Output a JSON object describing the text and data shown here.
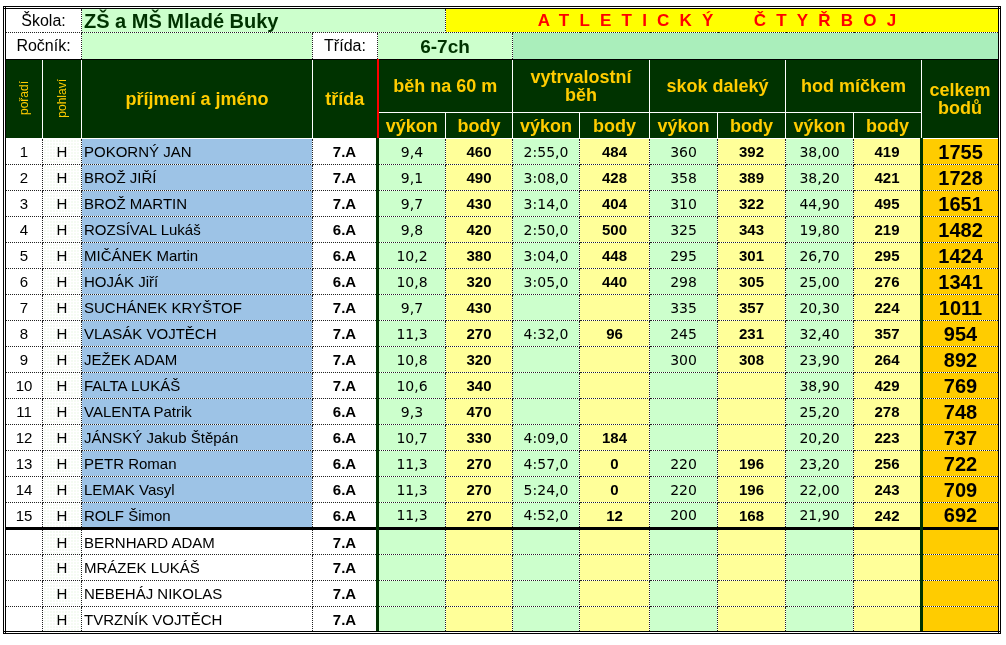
{
  "school": {
    "label": "Škola:",
    "value": "ZŠ a MŠ Mladé Buky"
  },
  "title": "ATLETICKÝ ČTYŘBOJ",
  "grade": {
    "label": "Ročník:"
  },
  "class_field": {
    "label": "Třída:",
    "value": "6-7ch"
  },
  "columns": {
    "rank": "pořadí",
    "sex": "pohlaví",
    "name": "příjmení a jméno",
    "class": "třída",
    "total": "celkem bodů",
    "sprint": {
      "title": "běh na 60 m",
      "result": "výkon",
      "points": "body"
    },
    "endurance": {
      "title": "vytrvalostní běh",
      "result": "výkon",
      "points": "body"
    },
    "long_jump": {
      "title": "skok daleký",
      "result": "výkon",
      "points": "body"
    },
    "throw": {
      "title": "hod míčkem",
      "result": "výkon",
      "points": "body"
    }
  },
  "rows": [
    {
      "rank": "1",
      "sex": "H",
      "name": "POKORNÝ JAN",
      "class": "7.A",
      "highlighted": true,
      "sprint": {
        "result": "9,4",
        "points": "460"
      },
      "endurance": {
        "result": "2:55,0",
        "points": "484"
      },
      "long_jump": {
        "result": "360",
        "points": "392"
      },
      "throw": {
        "result": "38,00",
        "points": "419"
      },
      "total": "1755"
    },
    {
      "rank": "2",
      "sex": "H",
      "name": "BROŽ JIŘÍ",
      "class": "7.A",
      "highlighted": true,
      "sprint": {
        "result": "9,1",
        "points": "490"
      },
      "endurance": {
        "result": "3:08,0",
        "points": "428"
      },
      "long_jump": {
        "result": "358",
        "points": "389"
      },
      "throw": {
        "result": "38,20",
        "points": "421"
      },
      "total": "1728"
    },
    {
      "rank": "3",
      "sex": "H",
      "name": "BROŽ MARTIN",
      "class": "7.A",
      "highlighted": true,
      "sprint": {
        "result": "9,7",
        "points": "430"
      },
      "endurance": {
        "result": "3:14,0",
        "points": "404"
      },
      "long_jump": {
        "result": "310",
        "points": "322"
      },
      "throw": {
        "result": "44,90",
        "points": "495"
      },
      "total": "1651"
    },
    {
      "rank": "4",
      "sex": "H",
      "name": "ROZSÍVAL Lukáš",
      "class": "6.A",
      "highlighted": true,
      "sprint": {
        "result": "9,8",
        "points": "420"
      },
      "endurance": {
        "result": "2:50,0",
        "points": "500"
      },
      "long_jump": {
        "result": "325",
        "points": "343"
      },
      "throw": {
        "result": "19,80",
        "points": "219"
      },
      "total": "1482"
    },
    {
      "rank": "5",
      "sex": "H",
      "name": "MIČÁNEK Martin",
      "class": "6.A",
      "highlighted": true,
      "sprint": {
        "result": "10,2",
        "points": "380"
      },
      "endurance": {
        "result": "3:04,0",
        "points": "448"
      },
      "long_jump": {
        "result": "295",
        "points": "301"
      },
      "throw": {
        "result": "26,70",
        "points": "295"
      },
      "total": "1424"
    },
    {
      "rank": "6",
      "sex": "H",
      "name": "HOJÁK Jiří",
      "class": "6.A",
      "highlighted": true,
      "sprint": {
        "result": "10,8",
        "points": "320"
      },
      "endurance": {
        "result": "3:05,0",
        "points": "440"
      },
      "long_jump": {
        "result": "298",
        "points": "305"
      },
      "throw": {
        "result": "25,00",
        "points": "276"
      },
      "total": "1341"
    },
    {
      "rank": "7",
      "sex": "H",
      "name": "SUCHÁNEK KRYŠTOF",
      "class": "7.A",
      "highlighted": true,
      "sprint": {
        "result": "9,7",
        "points": "430"
      },
      "long_jump": {
        "result": "335",
        "points": "357"
      },
      "throw": {
        "result": "20,30",
        "points": "224"
      },
      "total": "1011"
    },
    {
      "rank": "8",
      "sex": "H",
      "name": "VLASÁK VOJTĚCH",
      "class": "7.A",
      "highlighted": true,
      "sprint": {
        "result": "11,3",
        "points": "270"
      },
      "endurance": {
        "result": "4:32,0",
        "points": "96"
      },
      "long_jump": {
        "result": "245",
        "points": "231"
      },
      "throw": {
        "result": "32,40",
        "points": "357"
      },
      "total": "954"
    },
    {
      "rank": "9",
      "sex": "H",
      "name": "JEŽEK ADAM",
      "class": "7.A",
      "highlighted": true,
      "sprint": {
        "result": "10,8",
        "points": "320"
      },
      "long_jump": {
        "result": "300",
        "points": "308"
      },
      "throw": {
        "result": "23,90",
        "points": "264"
      },
      "total": "892"
    },
    {
      "rank": "10",
      "sex": "H",
      "name": "FALTA LUKÁŠ",
      "class": "7.A",
      "highlighted": true,
      "sprint": {
        "result": "10,6",
        "points": "340"
      },
      "throw": {
        "result": "38,90",
        "points": "429"
      },
      "total": "769"
    },
    {
      "rank": "11",
      "sex": "H",
      "name": "VALENTA Patrik",
      "class": "6.A",
      "highlighted": true,
      "sprint": {
        "result": "9,3",
        "points": "470"
      },
      "throw": {
        "result": "25,20",
        "points": "278"
      },
      "total": "748"
    },
    {
      "rank": "12",
      "sex": "H",
      "name": "JÁNSKÝ Jakub Štěpán",
      "class": "6.A",
      "highlighted": true,
      "sprint": {
        "result": "10,7",
        "points": "330"
      },
      "endurance": {
        "result": "4:09,0",
        "points": "184"
      },
      "throw": {
        "result": "20,20",
        "points": "223"
      },
      "total": "737"
    },
    {
      "rank": "13",
      "sex": "H",
      "name": "PETR Roman",
      "class": "6.A",
      "highlighted": true,
      "sprint": {
        "result": "11,3",
        "points": "270"
      },
      "endurance": {
        "result": "4:57,0",
        "points": "0"
      },
      "long_jump": {
        "result": "220",
        "points": "196"
      },
      "throw": {
        "result": "23,20",
        "points": "256"
      },
      "total": "722"
    },
    {
      "rank": "14",
      "sex": "H",
      "name": "LEMAK Vasyl",
      "class": "6.A",
      "highlighted": true,
      "sprint": {
        "result": "11,3",
        "points": "270"
      },
      "endurance": {
        "result": "5:24,0",
        "points": "0"
      },
      "long_jump": {
        "result": "220",
        "points": "196"
      },
      "throw": {
        "result": "22,00",
        "points": "243"
      },
      "total": "709"
    },
    {
      "rank": "15",
      "sex": "H",
      "name": "ROLF Šimon",
      "class": "6.A",
      "highlighted": true,
      "sprint": {
        "result": "11,3",
        "points": "270"
      },
      "endurance": {
        "result": "4:52,0",
        "points": "12"
      },
      "long_jump": {
        "result": "200",
        "points": "168"
      },
      "throw": {
        "result": "21,90",
        "points": "242"
      },
      "total": "692"
    },
    {
      "sex": "H",
      "name": "BERNHARD ADAM",
      "class": "7.A",
      "highlighted": false
    },
    {
      "sex": "H",
      "name": "MRÁZEK LUKÁŠ",
      "class": "7.A",
      "highlighted": false
    },
    {
      "sex": "H",
      "name": "NEBEHÁJ NIKOLAS",
      "class": "7.A",
      "highlighted": false
    },
    {
      "sex": "H",
      "name": "TVRZNÍK VOJTĚCH",
      "class": "7.A",
      "highlighted": false
    }
  ]
}
